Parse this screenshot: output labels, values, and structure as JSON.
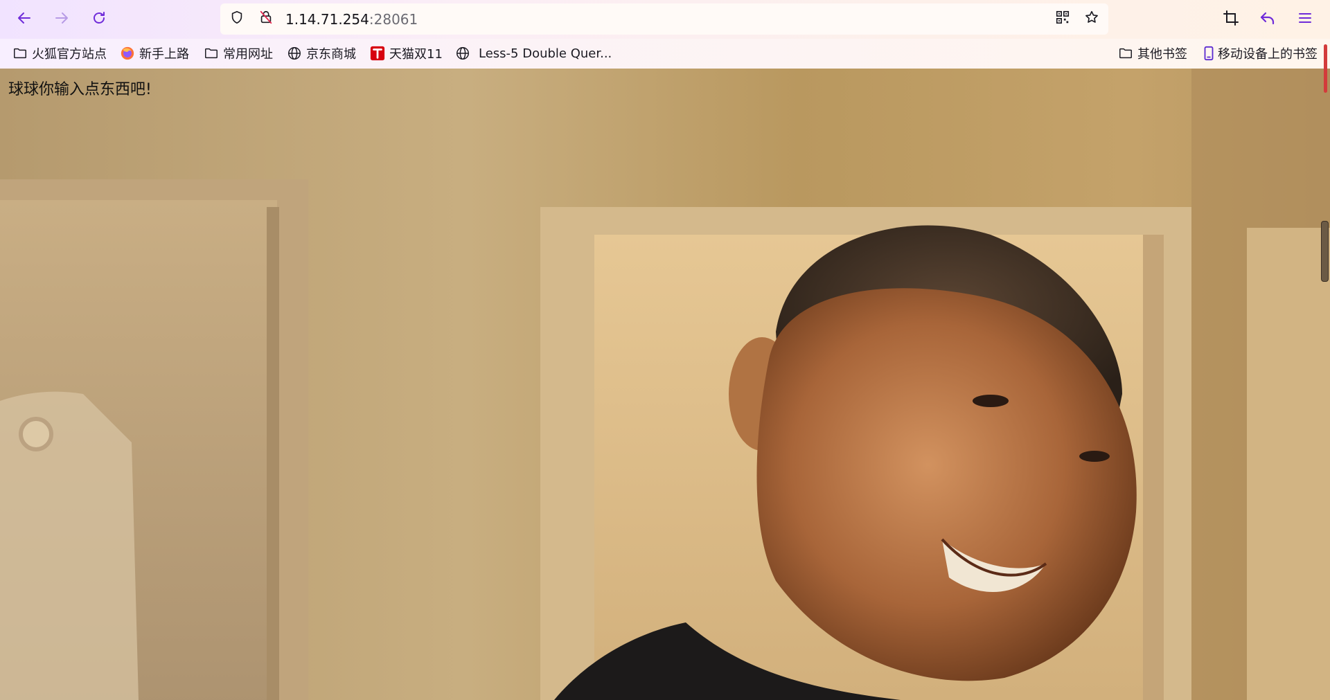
{
  "browser": {
    "url": {
      "host": "1.14.71.254",
      "port": ":28061"
    },
    "toolbar_icons": {
      "back": "arrow-left-icon",
      "forward": "arrow-right-icon",
      "reload": "reload-icon",
      "tracking_protection": "shield-icon",
      "connection": "insecure-lock-icon",
      "qr_code": "qr-code-icon",
      "bookmark_star": "star-icon",
      "screenshot": "crop-icon",
      "undo_closed": "undo-arrow-icon",
      "menu": "hamburger-menu-icon"
    },
    "accent_color": "#6f2bd9"
  },
  "bookmarks": {
    "left": [
      {
        "label": "火狐官方站点",
        "icon": "folder-icon"
      },
      {
        "label": "新手上路",
        "icon": "firefox-icon"
      },
      {
        "label": "常用网址",
        "icon": "folder-icon"
      },
      {
        "label": "京东商城",
        "icon": "globe-icon"
      },
      {
        "label": "天猫双11",
        "icon": "tmall-icon"
      },
      {
        "label": "Less-5 Double Quer...",
        "icon": "globe-icon"
      }
    ],
    "right": [
      {
        "label": "其他书签",
        "icon": "folder-icon"
      },
      {
        "label": "移动设备上的书签",
        "icon": "mobile-icon"
      }
    ]
  },
  "page": {
    "message": "球球你输入点东西吧!"
  }
}
